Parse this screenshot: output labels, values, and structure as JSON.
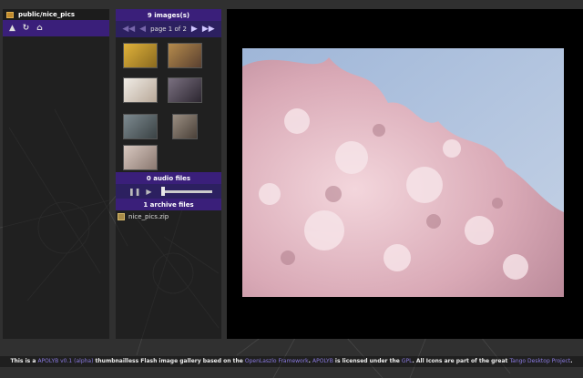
{
  "folder": {
    "path": "public/nice_pics"
  },
  "thumbs": {
    "header": "9 images(s)",
    "page_label": "page 1 of 2",
    "colors": [
      "#c79a2c",
      "#8c6a3c",
      "#d9d0c4",
      "#4a4450",
      "#5e6a70",
      "#7a7066",
      "#b9a8a0"
    ]
  },
  "audio": {
    "label": "0 audio files"
  },
  "archives": {
    "label": "1 archive files",
    "items": [
      "nice_pics.zip"
    ]
  },
  "footer": {
    "t1": "This is a ",
    "apolyb": "APOLYB v0.1 (alpha)",
    "t2": " thumbnailless Flash image gallery based on the ",
    "framework": "OpenLaszlo Framework",
    "t3": ". ",
    "apolyb2": "APOLYB",
    "t4": " is licensed under the ",
    "gpl": "GPL",
    "t5": ". All Icons are part of the great ",
    "tango": "Tango Desktop Project",
    "t6": "."
  }
}
